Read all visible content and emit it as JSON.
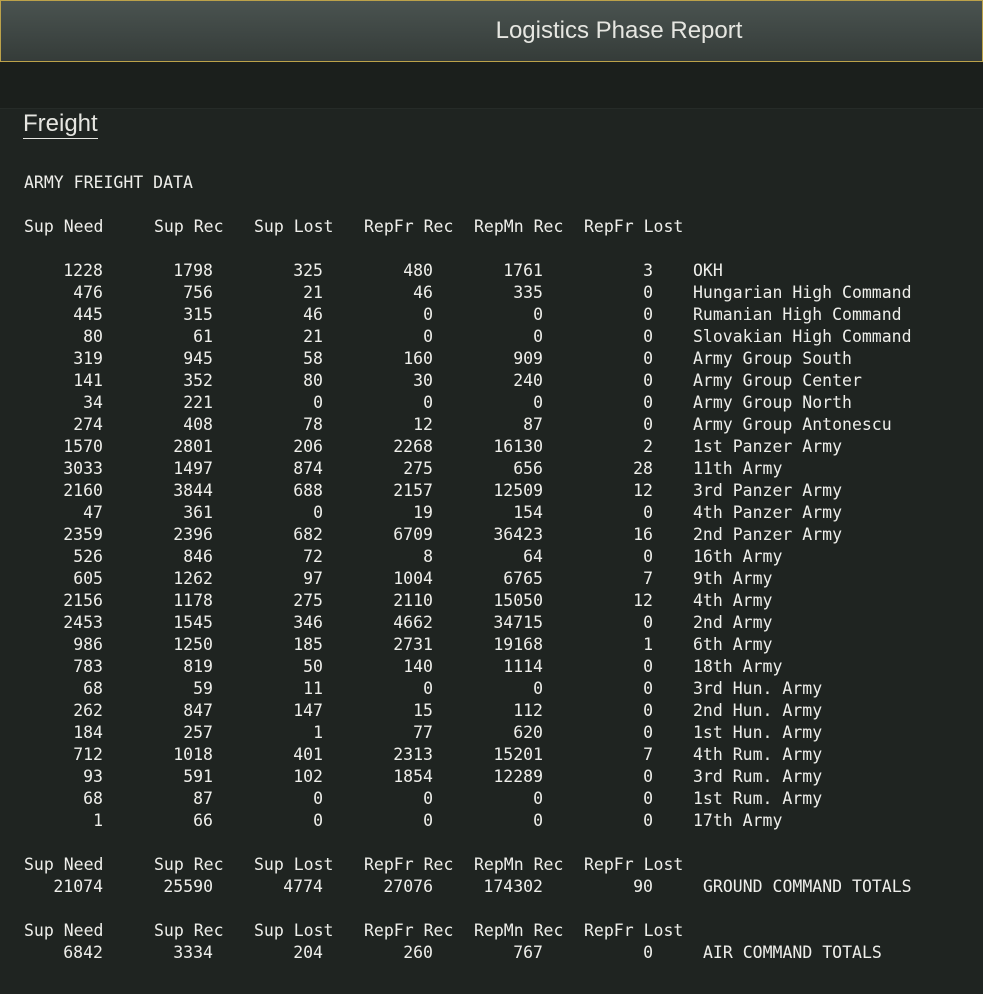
{
  "window": {
    "title": "Logistics Phase Report"
  },
  "section": {
    "heading": "Freight",
    "subtitle": "ARMY FREIGHT DATA"
  },
  "columns": [
    "Sup Need",
    "Sup Rec",
    "Sup Lost",
    "RepFr Rec",
    "RepMn Rec",
    "RepFr Lost"
  ],
  "rows": [
    {
      "values": [
        "1228",
        "1798",
        "325",
        "480",
        "1761",
        "3"
      ],
      "name": "OKH"
    },
    {
      "values": [
        "476",
        "756",
        "21",
        "46",
        "335",
        "0"
      ],
      "name": "Hungarian High Command"
    },
    {
      "values": [
        "445",
        "315",
        "46",
        "0",
        "0",
        "0"
      ],
      "name": "Rumanian High Command"
    },
    {
      "values": [
        "80",
        "61",
        "21",
        "0",
        "0",
        "0"
      ],
      "name": "Slovakian High Command"
    },
    {
      "values": [
        "319",
        "945",
        "58",
        "160",
        "909",
        "0"
      ],
      "name": "Army Group South"
    },
    {
      "values": [
        "141",
        "352",
        "80",
        "30",
        "240",
        "0"
      ],
      "name": "Army Group Center"
    },
    {
      "values": [
        "34",
        "221",
        "0",
        "0",
        "0",
        "0"
      ],
      "name": "Army Group North"
    },
    {
      "values": [
        "274",
        "408",
        "78",
        "12",
        "87",
        "0"
      ],
      "name": "Army Group Antonescu"
    },
    {
      "values": [
        "1570",
        "2801",
        "206",
        "2268",
        "16130",
        "2"
      ],
      "name": "1st Panzer Army"
    },
    {
      "values": [
        "3033",
        "1497",
        "874",
        "275",
        "656",
        "28"
      ],
      "name": "11th Army"
    },
    {
      "values": [
        "2160",
        "3844",
        "688",
        "2157",
        "12509",
        "12"
      ],
      "name": "3rd Panzer Army"
    },
    {
      "values": [
        "47",
        "361",
        "0",
        "19",
        "154",
        "0"
      ],
      "name": "4th Panzer Army"
    },
    {
      "values": [
        "2359",
        "2396",
        "682",
        "6709",
        "36423",
        "16"
      ],
      "name": "2nd Panzer Army"
    },
    {
      "values": [
        "526",
        "846",
        "72",
        "8",
        "64",
        "0"
      ],
      "name": "16th Army"
    },
    {
      "values": [
        "605",
        "1262",
        "97",
        "1004",
        "6765",
        "7"
      ],
      "name": "9th Army"
    },
    {
      "values": [
        "2156",
        "1178",
        "275",
        "2110",
        "15050",
        "12"
      ],
      "name": "4th Army"
    },
    {
      "values": [
        "2453",
        "1545",
        "346",
        "4662",
        "34715",
        "0"
      ],
      "name": "2nd Army"
    },
    {
      "values": [
        "986",
        "1250",
        "185",
        "2731",
        "19168",
        "1"
      ],
      "name": "6th Army"
    },
    {
      "values": [
        "783",
        "819",
        "50",
        "140",
        "1114",
        "0"
      ],
      "name": "18th Army"
    },
    {
      "values": [
        "68",
        "59",
        "11",
        "0",
        "0",
        "0"
      ],
      "name": "3rd Hun. Army"
    },
    {
      "values": [
        "262",
        "847",
        "147",
        "15",
        "112",
        "0"
      ],
      "name": "2nd Hun. Army"
    },
    {
      "values": [
        "184",
        "257",
        "1",
        "77",
        "620",
        "0"
      ],
      "name": "1st Hun. Army"
    },
    {
      "values": [
        "712",
        "1018",
        "401",
        "2313",
        "15201",
        "7"
      ],
      "name": "4th Rum. Army"
    },
    {
      "values": [
        "93",
        "591",
        "102",
        "1854",
        "12289",
        "0"
      ],
      "name": "3rd Rum. Army"
    },
    {
      "values": [
        "68",
        "87",
        "0",
        "0",
        "0",
        "0"
      ],
      "name": "1st Rum. Army"
    },
    {
      "values": [
        "1",
        "66",
        "0",
        "0",
        "0",
        "0"
      ],
      "name": "17th Army"
    }
  ],
  "ground_totals": {
    "values": [
      "21074",
      "25590",
      "4774",
      "27076",
      "174302",
      "90"
    ],
    "label": "GROUND COMMAND TOTALS"
  },
  "air_totals": {
    "values": [
      "6842",
      "3334",
      "204",
      "260",
      "767",
      "0"
    ],
    "label": "AIR COMMAND TOTALS"
  }
}
